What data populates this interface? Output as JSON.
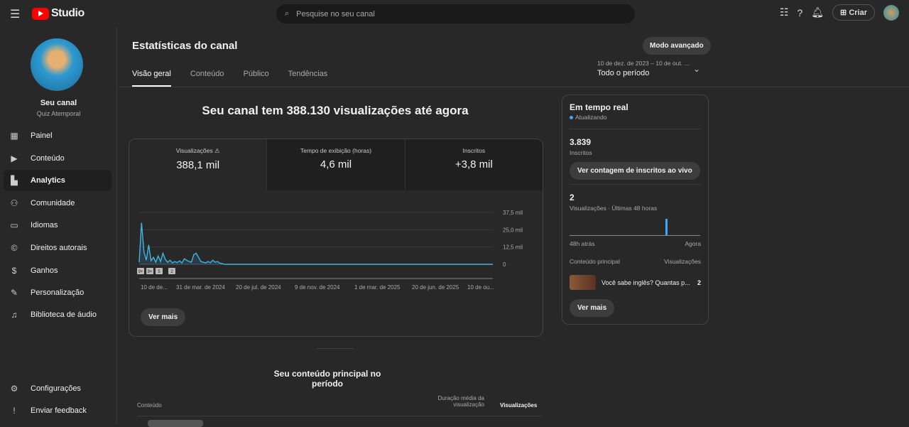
{
  "topbar": {
    "brand": "Studio",
    "search_placeholder": "Pesquise no seu canal",
    "create_label": "Criar"
  },
  "channel": {
    "name": "Seu canal",
    "handle": "Quiz Atemporal"
  },
  "sidebar": {
    "items": [
      {
        "label": "Painel",
        "icon": "dashboard-icon"
      },
      {
        "label": "Conteúdo",
        "icon": "content-icon"
      },
      {
        "label": "Analytics",
        "icon": "analytics-icon",
        "active": true
      },
      {
        "label": "Comunidade",
        "icon": "community-icon"
      },
      {
        "label": "Idiomas",
        "icon": "subtitles-icon"
      },
      {
        "label": "Direitos autorais",
        "icon": "copyright-icon"
      },
      {
        "label": "Ganhos",
        "icon": "dollar-icon"
      },
      {
        "label": "Personalização",
        "icon": "magic-wand-icon"
      },
      {
        "label": "Biblioteca de áudio",
        "icon": "audio-library-icon"
      }
    ],
    "bottom": [
      {
        "label": "Configurações",
        "icon": "gear-icon"
      },
      {
        "label": "Enviar feedback",
        "icon": "feedback-icon"
      }
    ]
  },
  "page": {
    "title": "Estatísticas do canal",
    "advanced_label": "Modo avançado",
    "tabs": [
      "Visão geral",
      "Conteúdo",
      "Público",
      "Tendências"
    ],
    "period_range": "10 de dez. de 2023 – 10 de out. ...",
    "period": "Todo o período",
    "headline": "Seu canal tem 388.130 visualizações até agora",
    "see_more": "Ver mais"
  },
  "metrics": [
    {
      "label": "Visualizações",
      "value": "388,1 mil"
    },
    {
      "label": "Tempo de exibição (horas)",
      "value": "4,6 mil"
    },
    {
      "label": "Inscritos",
      "value": "+3,8 mil"
    }
  ],
  "chart_data": {
    "type": "line",
    "series": [
      {
        "name": "Visualizações",
        "values": [
          1500,
          30000,
          9000,
          3000,
          14000,
          2500,
          5000,
          1500,
          6000,
          2000,
          8000,
          3500,
          1500,
          3000,
          1000,
          2000,
          1200,
          2500,
          1000,
          4000,
          3000,
          2000,
          1500,
          7000,
          8000,
          5000,
          2000,
          1500,
          1000,
          2000,
          1200,
          3000,
          1500,
          2000,
          800,
          500,
          0,
          0,
          0,
          0,
          0,
          0,
          0,
          0,
          0,
          0,
          0,
          0,
          0,
          0,
          0,
          0,
          0,
          0,
          0,
          0,
          0,
          0,
          0,
          0,
          0,
          0,
          0,
          0,
          0,
          0,
          0,
          0,
          0,
          0,
          0,
          0,
          0,
          0,
          0,
          0,
          0,
          0,
          0,
          0,
          0,
          0,
          0,
          0,
          0,
          0,
          0,
          0,
          0,
          0,
          0,
          0,
          0,
          0,
          0,
          0,
          0,
          0,
          0,
          0,
          0,
          0,
          0,
          0,
          0,
          0,
          0,
          0,
          0,
          0,
          0,
          0,
          0,
          0,
          0,
          0,
          0,
          0,
          0,
          0,
          0,
          0,
          0,
          0,
          0,
          0,
          0,
          0,
          0,
          0,
          0,
          0,
          0,
          0,
          0,
          0,
          0,
          0,
          0,
          0,
          0,
          0,
          0,
          0,
          0,
          0,
          0,
          0,
          0,
          0
        ]
      }
    ],
    "ylim": [
      0,
      37500
    ],
    "yticks": [
      "37,5 mil",
      "25,0 mil",
      "12,5 mil",
      "0"
    ],
    "xticks": [
      "10 de de...",
      "31 de mar. de 2024",
      "20 de jul. de 2024",
      "9 de nov. de 2024",
      "1 de mar. de 2025",
      "20 de jun. de 2025",
      "10 de ou..."
    ],
    "badges": [
      "9+",
      "9+",
      "5",
      "2"
    ]
  },
  "realtime": {
    "title": "Em tempo real",
    "status": "Atualizando",
    "subs": "3.839",
    "subs_label": "Inscritos",
    "live_button": "Ver contagem de inscritos ao vivo",
    "views": "2",
    "views_label": "Visualizações · Últimas 48 horas",
    "start": "48h atrás",
    "end": "Agora",
    "top_label": "Conteúdo principal",
    "views_col": "Visualizações",
    "top_item": {
      "title": "Você sabe inglês? Quantas p...",
      "views": "2"
    },
    "see_more": "Ver mais"
  },
  "top_content": {
    "title": "Seu conteúdo principal no período",
    "col_content": "Conteúdo",
    "col_duration": "Duração média da visualização",
    "col_views": "Visualizações"
  }
}
